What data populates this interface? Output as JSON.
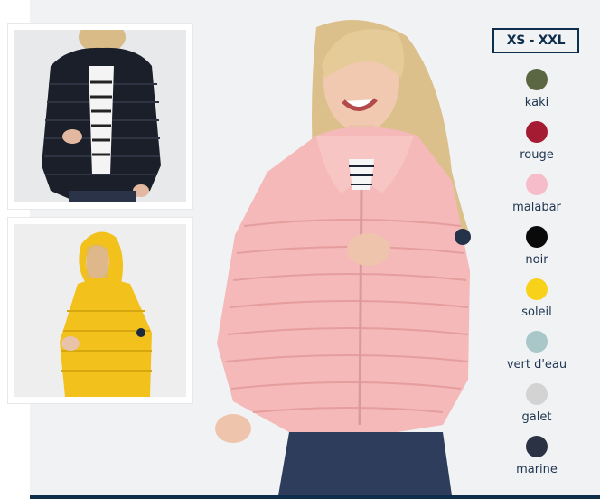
{
  "product": {
    "size_range": "XS - XXL",
    "thumbnails": [
      {
        "alt": "navy-jacket-thumbnail",
        "color": "#1b1f29"
      },
      {
        "alt": "yellow-jacket-thumbnail",
        "color": "#f2c11c"
      }
    ],
    "hero_jacket_color": "#f4b9b8",
    "colors": [
      {
        "name": "kaki",
        "hex": "#5b6643"
      },
      {
        "name": "rouge",
        "hex": "#a51b32"
      },
      {
        "name": "malabar",
        "hex": "#f6bcc9"
      },
      {
        "name": "noir",
        "hex": "#0a0a0a"
      },
      {
        "name": "soleil",
        "hex": "#f7d11a"
      },
      {
        "name": "vert d'eau",
        "hex": "#a9c6c8"
      },
      {
        "name": "galet",
        "hex": "#d3d3d3"
      },
      {
        "name": "marine",
        "hex": "#2b3243"
      }
    ]
  },
  "theme": {
    "accent": "#0f2e4c",
    "background": "#f1f2f4"
  }
}
